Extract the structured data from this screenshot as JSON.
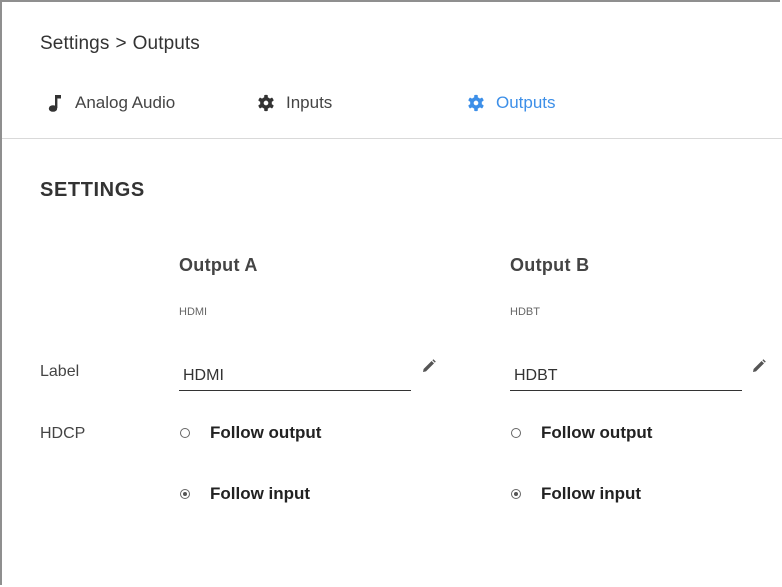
{
  "breadcrumb": {
    "root": "Settings",
    "separator": ">",
    "current": "Outputs"
  },
  "tabs": [
    {
      "label": "Analog Audio",
      "icon": "music-note-icon",
      "active": false
    },
    {
      "label": "Inputs",
      "icon": "gear-icon",
      "active": false
    },
    {
      "label": "Outputs",
      "icon": "gear-icon",
      "active": true
    }
  ],
  "section": {
    "title": "SETTINGS"
  },
  "row_labels": {
    "label": "Label",
    "hdcp": "HDCP"
  },
  "outputs": [
    {
      "title": "Output A",
      "type": "HDMI",
      "label_value": "HDMI",
      "hdcp_options": [
        {
          "label": "Follow output",
          "selected": false
        },
        {
          "label": "Follow input",
          "selected": true
        }
      ]
    },
    {
      "title": "Output B",
      "type": "HDBT",
      "label_value": "HDBT",
      "hdcp_options": [
        {
          "label": "Follow output",
          "selected": false
        },
        {
          "label": "Follow input",
          "selected": true
        }
      ]
    }
  ],
  "colors": {
    "accent": "#3d8fe8",
    "text": "#333333",
    "divider": "#d9d9d9"
  }
}
